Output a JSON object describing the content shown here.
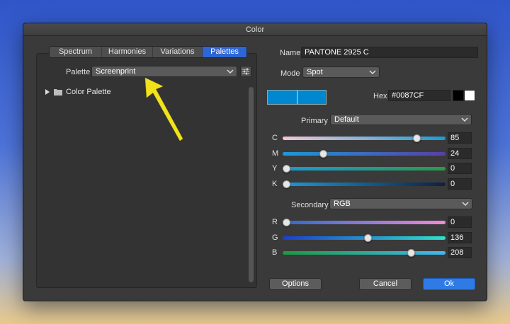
{
  "window": {
    "title": "Color"
  },
  "tabs": [
    "Spectrum",
    "Harmonies",
    "Variations",
    "Palettes"
  ],
  "active_tab": "Palettes",
  "palette": {
    "label": "Palette",
    "value": "Screenprint"
  },
  "tree": {
    "item": "Color Palette"
  },
  "name": {
    "label": "Name",
    "value": "PANTONE 2925 C"
  },
  "mode": {
    "label": "Mode",
    "value": "Spot"
  },
  "hex": {
    "label": "Hex",
    "value": "#0087CF"
  },
  "primary": {
    "label": "Primary",
    "value": "Default",
    "channels": [
      {
        "name": "C",
        "value": "85",
        "fraction": 0.85
      },
      {
        "name": "M",
        "value": "24",
        "fraction": 0.24
      },
      {
        "name": "Y",
        "value": "0",
        "fraction": 0.0
      },
      {
        "name": "K",
        "value": "0",
        "fraction": 0.0
      }
    ]
  },
  "secondary": {
    "label": "Secondary",
    "value": "RGB",
    "channels": [
      {
        "name": "R",
        "value": "0",
        "fraction": 0.0
      },
      {
        "name": "G",
        "value": "136",
        "fraction": 0.533
      },
      {
        "name": "B",
        "value": "208",
        "fraction": 0.816
      }
    ]
  },
  "buttons": {
    "options": "Options",
    "cancel": "Cancel",
    "ok": "Ok"
  },
  "colors": {
    "current": "#0087CF",
    "accent": "#2F66D6",
    "arrow": "#F2E21C"
  }
}
